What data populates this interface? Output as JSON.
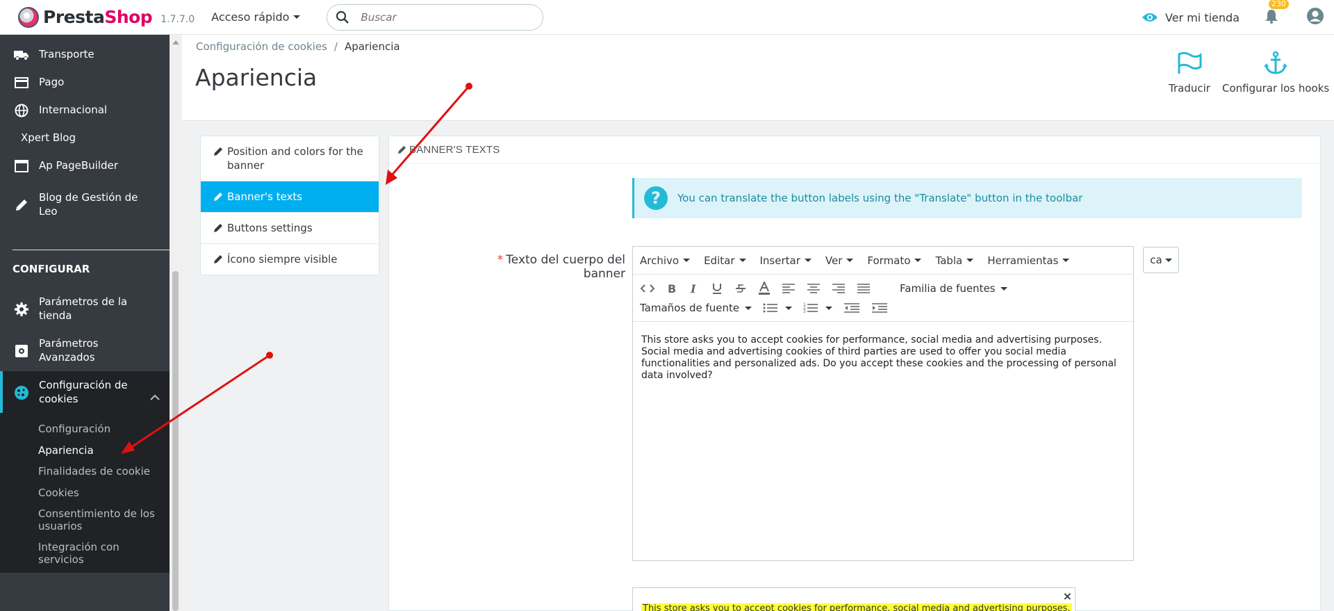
{
  "header": {
    "logo_prefix": "Presta",
    "logo_suffix": "Shop",
    "version": "1.7.7.0",
    "quick_access": "Acceso rápido",
    "search_placeholder": "Buscar",
    "view_store": "Ver mi tienda",
    "notifications_count": "230"
  },
  "sidebar": {
    "items": [
      {
        "label": "Transporte",
        "icon": "truck-icon"
      },
      {
        "label": "Pago",
        "icon": "credit-card-icon"
      },
      {
        "label": "Internacional",
        "icon": "globe-icon"
      },
      {
        "label": "Xpert Blog",
        "icon": ""
      },
      {
        "label": "Ap PageBuilder",
        "icon": "window-icon"
      },
      {
        "label": "Blog de Gestión de Leo",
        "icon": "pencil-icon"
      }
    ],
    "section_title": "CONFIGURAR",
    "config_items": [
      {
        "label": "Parámetros de la tienda",
        "icon": "gear-icon"
      },
      {
        "label": "Parámetros Avanzados",
        "icon": "settings-box-icon"
      },
      {
        "label": "Configuración de cookies",
        "icon": "cookie-icon"
      }
    ],
    "sub_items": [
      "Configuración",
      "Apariencia",
      "Finalidades de cookie",
      "Cookies",
      "Consentimiento de los usuarios",
      "Integración con servicios"
    ]
  },
  "page": {
    "breadcrumb_parent": "Configuración de cookies",
    "breadcrumb_sep": "/",
    "breadcrumb_current": "Apariencia",
    "title": "Apariencia",
    "translate_label": "Traducir",
    "hooks_label": "Configurar los hooks"
  },
  "tabs": [
    "Position and colors for the banner",
    "Banner's texts",
    "Buttons settings",
    "Ícono siempre visible"
  ],
  "panel": {
    "heading": "BANNER'S TEXTS",
    "alert": "You can translate the button labels using the \"Translate\" button in the toolbar",
    "field_required_mark": "*",
    "field_label": "Texto del cuerpo del banner",
    "language": "ca",
    "menubar": [
      "Archivo",
      "Editar",
      "Insertar",
      "Ver",
      "Formato",
      "Tabla",
      "Herramientas"
    ],
    "font_family": "Familia de fuentes",
    "font_size": "Tamaños de fuente",
    "body_text": "This store asks you to accept cookies for performance, social media and advertising purposes. Social media and advertising cookies of third parties are used to offer you social media functionalities and personalized ads. Do you accept these cookies and the processing of personal data involved?",
    "preview_close": "×",
    "preview_text": "This store asks you to accept cookies for performance, social media and advertising purposes."
  },
  "colors": {
    "accent": "#25b9d7",
    "active_tab": "#00aff0",
    "sidebar": "#363a41",
    "arrow": "#e01010"
  }
}
